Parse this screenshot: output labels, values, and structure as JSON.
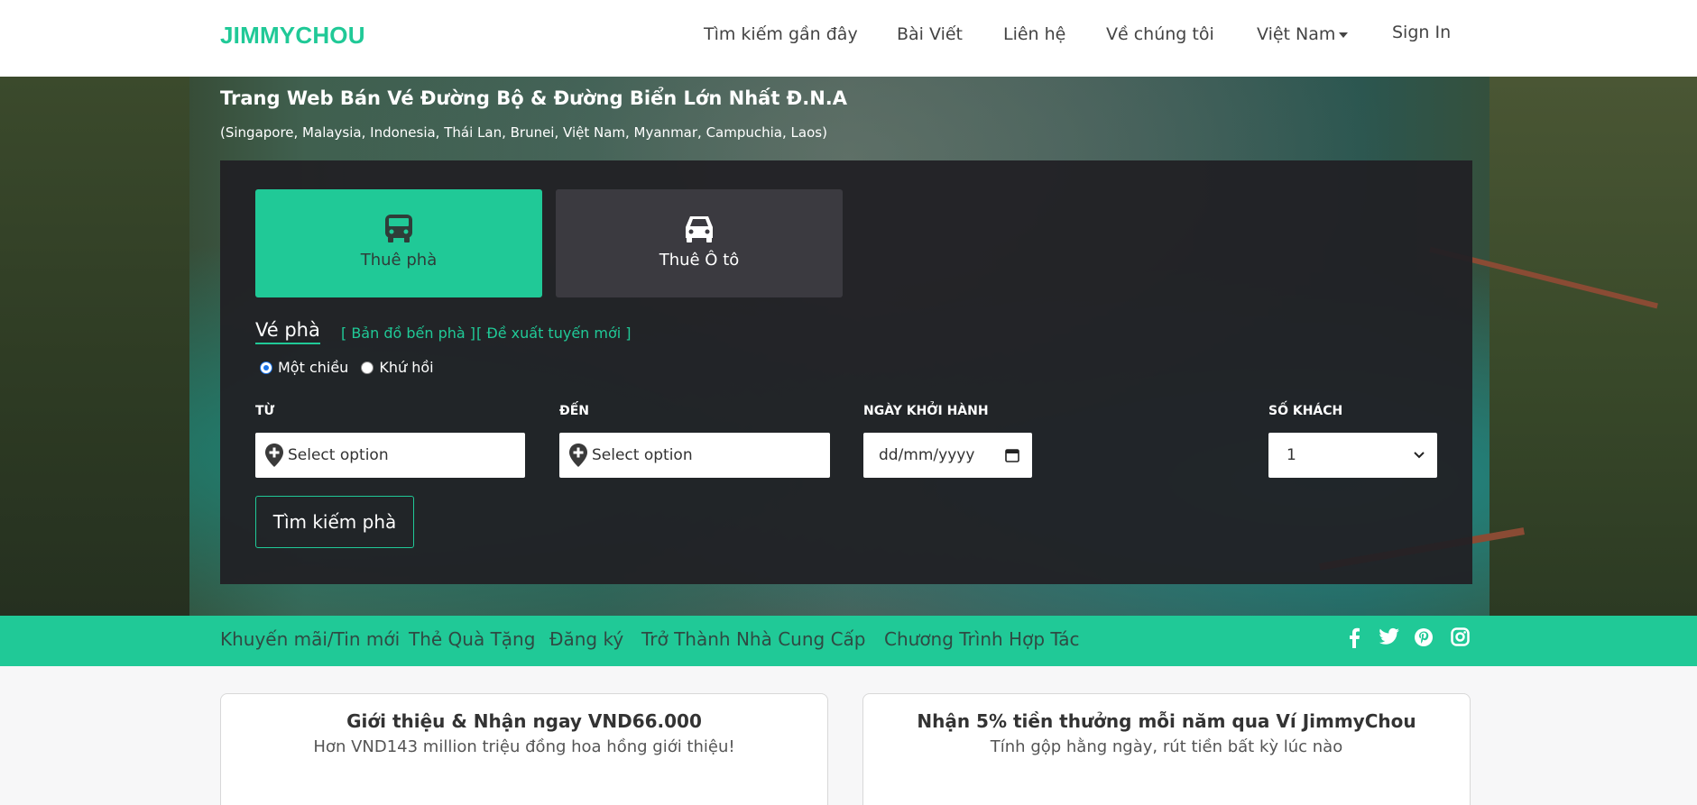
{
  "navbar": {
    "brand": "JIMMYCHOU",
    "items": [
      {
        "label": "Tìm kiếm gần đây"
      },
      {
        "label": "Bài Viết"
      },
      {
        "label": "Liên hệ"
      },
      {
        "label": "Về chúng tôi"
      },
      {
        "label": "Việt Nam"
      },
      {
        "label": "Sign In"
      }
    ]
  },
  "hero": {
    "title": "Trang Web Bán Vé Đường Bộ & Đường Biển Lớn Nhất Đ.N.A",
    "subtitle": "(Singapore, Malaysia, Indonesia, Thái Lan, Brunei, Việt Nam, Myanmar, Campuchia, Laos)"
  },
  "search": {
    "modes": [
      {
        "label": "Thuê phà",
        "icon": "bus-icon",
        "active": true
      },
      {
        "label": "Thuê Ô tô",
        "icon": "car-icon",
        "active": false
      }
    ],
    "active_tab": "Vé phà",
    "links": [
      "[ Bản đồ bến phà ]",
      "[ Đề xuất tuyến mới ]"
    ],
    "trip_types": [
      {
        "label": "Một chiều",
        "selected": true
      },
      {
        "label": "Khứ hồi",
        "selected": false
      }
    ],
    "from": {
      "label": "TỪ",
      "placeholder": "Select option"
    },
    "to": {
      "label": "ĐẾN",
      "placeholder": "Select option"
    },
    "date": {
      "label": "NGÀY KHỞI HÀNH",
      "placeholder": "dd/mm/yyyy"
    },
    "passengers": {
      "label": "SỐ KHÁCH",
      "value": "1"
    },
    "submit_label": "Tìm kiếm phà"
  },
  "promo_bar": {
    "links": [
      "Khuyến mãi/Tin mới",
      "Thẻ Quà Tặng",
      "Đăng ký",
      "Trở Thành Nhà Cung Cấp",
      "Chương Trình Hợp Tác"
    ],
    "social_icons": [
      "facebook-icon",
      "twitter-icon",
      "pinterest-icon",
      "instagram-icon"
    ]
  },
  "cards": [
    {
      "title": "Giới thiệu & Nhận ngay VND66.000",
      "text": "Hơn VND143 million triệu đồng hoa hồng giới thiệu!"
    },
    {
      "title": "Nhận 5% tiền thưởng mỗi năm qua Ví JimmyChou",
      "text": "Tính gộp hằng ngày, rút tiền bất kỳ lúc nào"
    }
  ],
  "colors": {
    "accent": "#20c997",
    "panel": "#212024",
    "car_button": "#3b3a40"
  }
}
